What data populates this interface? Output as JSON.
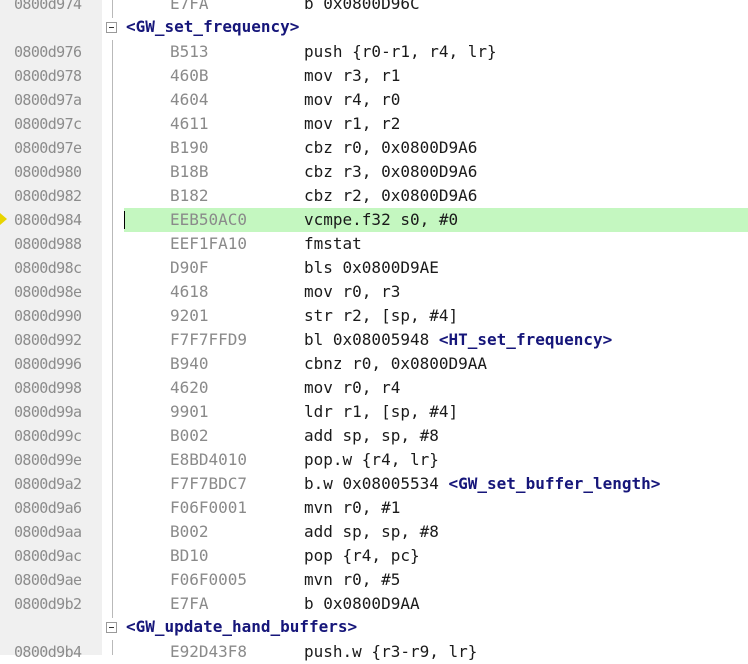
{
  "disassembly": {
    "rows": [
      {
        "kind": "code",
        "addr": "0800d974",
        "opcode": "E7FA",
        "mnemonic": "b 0x0800D96C",
        "symbol": "",
        "current": false
      },
      {
        "kind": "label",
        "label": "<GW_set_frequency>"
      },
      {
        "kind": "code",
        "addr": "0800d976",
        "opcode": "B513",
        "mnemonic": "push {r0-r1, r4, lr}",
        "symbol": "",
        "current": false
      },
      {
        "kind": "code",
        "addr": "0800d978",
        "opcode": "460B",
        "mnemonic": "mov r3, r1",
        "symbol": "",
        "current": false
      },
      {
        "kind": "code",
        "addr": "0800d97a",
        "opcode": "4604",
        "mnemonic": "mov r4, r0",
        "symbol": "",
        "current": false
      },
      {
        "kind": "code",
        "addr": "0800d97c",
        "opcode": "4611",
        "mnemonic": "mov r1, r2",
        "symbol": "",
        "current": false
      },
      {
        "kind": "code",
        "addr": "0800d97e",
        "opcode": "B190",
        "mnemonic": "cbz r0, 0x0800D9A6",
        "symbol": "",
        "current": false
      },
      {
        "kind": "code",
        "addr": "0800d980",
        "opcode": "B18B",
        "mnemonic": "cbz r3, 0x0800D9A6",
        "symbol": "",
        "current": false
      },
      {
        "kind": "code",
        "addr": "0800d982",
        "opcode": "B182",
        "mnemonic": "cbz r2, 0x0800D9A6",
        "symbol": "",
        "current": false
      },
      {
        "kind": "code",
        "addr": "0800d984",
        "opcode": "EEB50AC0",
        "mnemonic": "vcmpe.f32 s0, #0",
        "symbol": "",
        "current": true
      },
      {
        "kind": "code",
        "addr": "0800d988",
        "opcode": "EEF1FA10",
        "mnemonic": "fmstat",
        "symbol": "",
        "current": false
      },
      {
        "kind": "code",
        "addr": "0800d98c",
        "opcode": "D90F",
        "mnemonic": "bls 0x0800D9AE",
        "symbol": "",
        "current": false
      },
      {
        "kind": "code",
        "addr": "0800d98e",
        "opcode": "4618",
        "mnemonic": "mov r0, r3",
        "symbol": "",
        "current": false
      },
      {
        "kind": "code",
        "addr": "0800d990",
        "opcode": "9201",
        "mnemonic": "str r2, [sp, #4]",
        "symbol": "",
        "current": false
      },
      {
        "kind": "code",
        "addr": "0800d992",
        "opcode": "F7F7FFD9",
        "mnemonic": "bl 0x08005948",
        "symbol": "<HT_set_frequency>",
        "current": false
      },
      {
        "kind": "code",
        "addr": "0800d996",
        "opcode": "B940",
        "mnemonic": "cbnz r0, 0x0800D9AA",
        "symbol": "",
        "current": false
      },
      {
        "kind": "code",
        "addr": "0800d998",
        "opcode": "4620",
        "mnemonic": "mov r0, r4",
        "symbol": "",
        "current": false
      },
      {
        "kind": "code",
        "addr": "0800d99a",
        "opcode": "9901",
        "mnemonic": "ldr r1, [sp, #4]",
        "symbol": "",
        "current": false
      },
      {
        "kind": "code",
        "addr": "0800d99c",
        "opcode": "B002",
        "mnemonic": "add sp, sp, #8",
        "symbol": "",
        "current": false
      },
      {
        "kind": "code",
        "addr": "0800d99e",
        "opcode": "E8BD4010",
        "mnemonic": "pop.w {r4, lr}",
        "symbol": "",
        "current": false
      },
      {
        "kind": "code",
        "addr": "0800d9a2",
        "opcode": "F7F7BDC7",
        "mnemonic": "b.w 0x08005534",
        "symbol": "<GW_set_buffer_length>",
        "current": false
      },
      {
        "kind": "code",
        "addr": "0800d9a6",
        "opcode": "F06F0001",
        "mnemonic": "mvn r0, #1",
        "symbol": "",
        "current": false
      },
      {
        "kind": "code",
        "addr": "0800d9aa",
        "opcode": "B002",
        "mnemonic": "add sp, sp, #8",
        "symbol": "",
        "current": false
      },
      {
        "kind": "code",
        "addr": "0800d9ac",
        "opcode": "BD10",
        "mnemonic": "pop {r4, pc}",
        "symbol": "",
        "current": false
      },
      {
        "kind": "code",
        "addr": "0800d9ae",
        "opcode": "F06F0005",
        "mnemonic": "mvn r0, #5",
        "symbol": "",
        "current": false
      },
      {
        "kind": "code",
        "addr": "0800d9b2",
        "opcode": "E7FA",
        "mnemonic": "b 0x0800D9AA",
        "symbol": "",
        "current": false
      },
      {
        "kind": "label",
        "label": "<GW_update_hand_buffers>"
      },
      {
        "kind": "code",
        "addr": "0800d9b4",
        "opcode": "E92D43F8",
        "mnemonic": "push.w {r3-r9, lr}",
        "symbol": "",
        "current": false
      }
    ]
  },
  "colors": {
    "current_line_bg": "#c4f7c0",
    "label_color": "#16167a",
    "execution_arrow": "#e8d400",
    "gutter_bg": "#f0f0f0"
  }
}
